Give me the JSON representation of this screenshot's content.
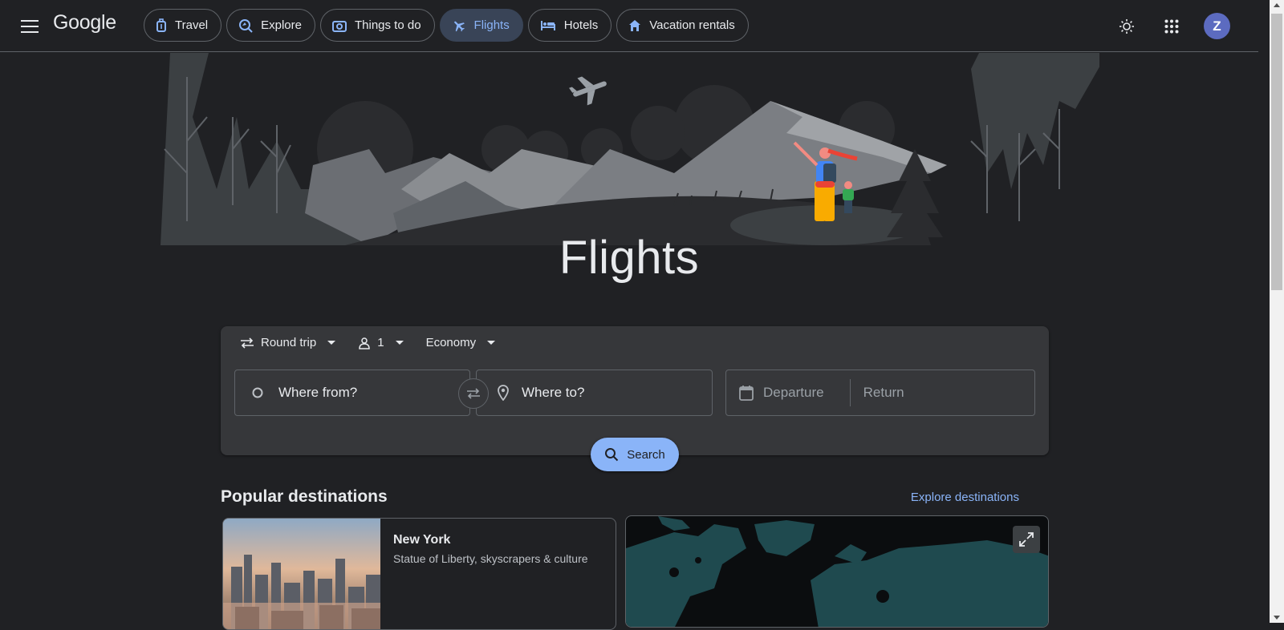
{
  "header": {
    "logo": "Google",
    "nav": [
      {
        "label": "Travel",
        "icon": "luggage-icon",
        "active": false
      },
      {
        "label": "Explore",
        "icon": "explore-icon",
        "active": false
      },
      {
        "label": "Things to do",
        "icon": "camera-icon",
        "active": false
      },
      {
        "label": "Flights",
        "icon": "airplane-icon",
        "active": true
      },
      {
        "label": "Hotels",
        "icon": "bed-icon",
        "active": false
      },
      {
        "label": "Vacation rentals",
        "icon": "house-icon",
        "active": false
      }
    ],
    "avatar_initial": "Z"
  },
  "hero": {
    "title": "Flights"
  },
  "search": {
    "trip_type": "Round trip",
    "passengers": "1",
    "cabin_class": "Economy",
    "from_placeholder": "Where from?",
    "to_placeholder": "Where to?",
    "departure_placeholder": "Departure",
    "return_placeholder": "Return",
    "search_label": "Search"
  },
  "popular": {
    "title": "Popular destinations",
    "explore_link": "Explore destinations",
    "destinations": [
      {
        "name": "New York",
        "description": "Statue of Liberty, skyscrapers & culture"
      }
    ]
  },
  "colors": {
    "background": "#202124",
    "accent": "#8ab4f8",
    "active_chip": "#394457",
    "card": "#36373a"
  }
}
